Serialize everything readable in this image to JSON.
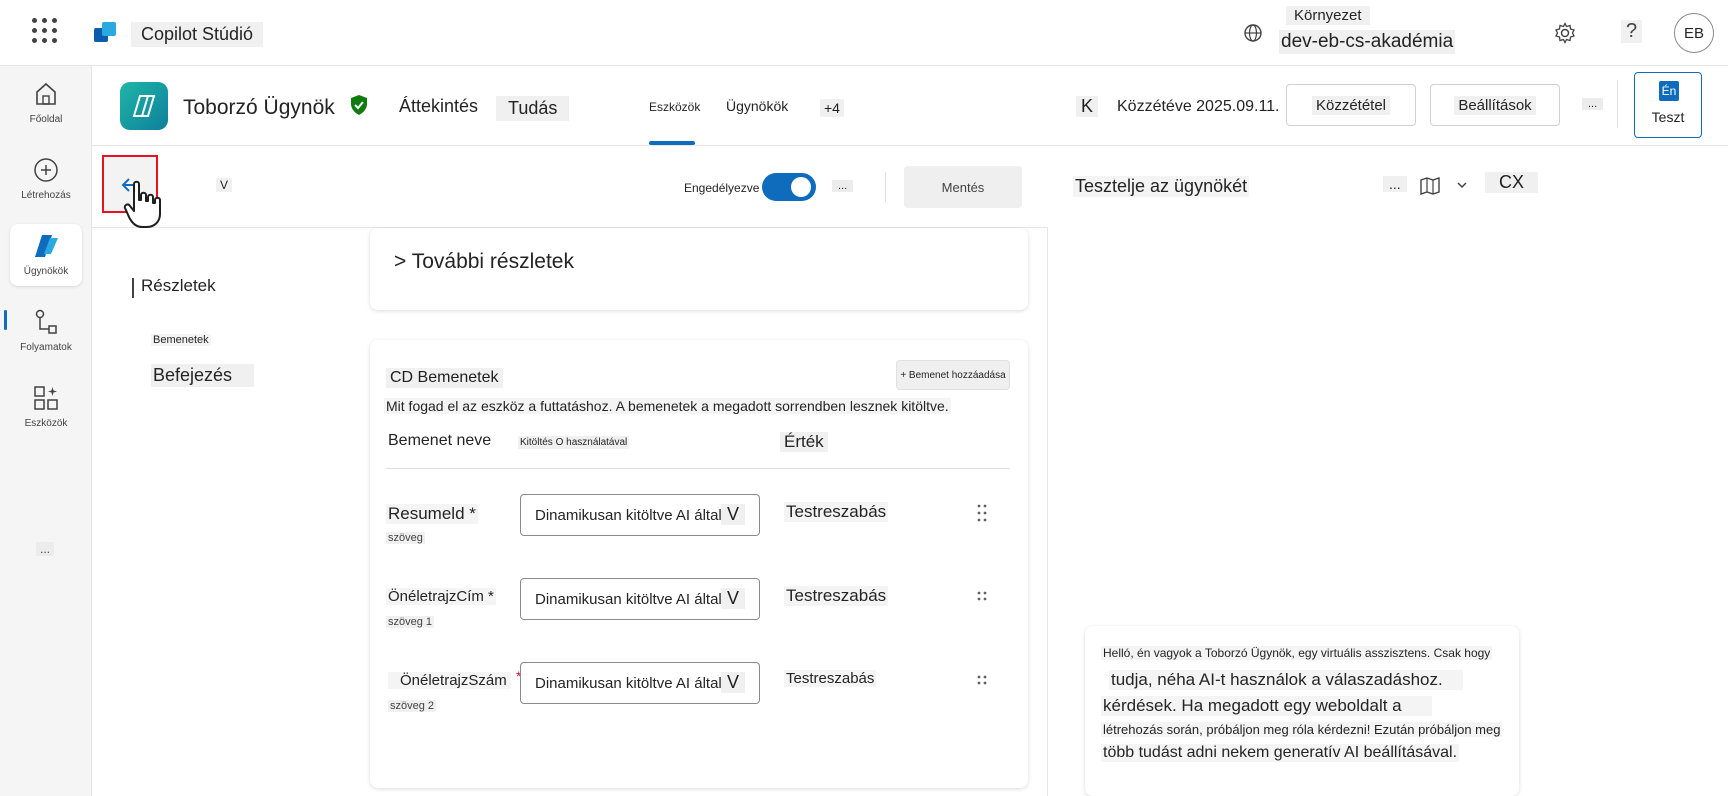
{
  "topbar": {
    "app_name": "Copilot Stúdió",
    "env_label": "Környezet",
    "env_name": "dev-eb-cs-akadémia",
    "help": "?",
    "avatar_initials": "EB"
  },
  "rail": {
    "home": "Főoldal",
    "create": "Létrehozás",
    "agents": "Ügynökök",
    "flows": "Folyamatok",
    "tools": "Eszközök",
    "more": "..."
  },
  "agent": {
    "name": "Toborzó Ügynök",
    "tabs": {
      "overview": "Áttekintés",
      "knowledge": "Tudás",
      "tools": "Eszközök",
      "agents": "Ügynökök",
      "more": "+4"
    },
    "k_label": "K",
    "published_status": "Közzétéve 2025.09.11.",
    "publish_button": "Közzététel",
    "settings_button": "Beállítások",
    "more": "...",
    "test_button": "Teszt",
    "test_icon_text": "Én"
  },
  "toolbar": {
    "dropdown_chevron": "V",
    "enabled_label": "Engedélyezve",
    "more": "...",
    "save_button": "Mentés"
  },
  "side_nav": {
    "details": "Részletek",
    "inputs": "Bemenetek",
    "completion": "Befejezés"
  },
  "more_details": "> További részletek",
  "inputs_card": {
    "title": "CD Bemenetek",
    "add_button": "+ Bemenet hozzáadása",
    "description": "Mit fogad el az eszköz a futtatáshoz. A bemenetek a megadott sorrendben lesznek kitöltve.",
    "col_name": "Bemenet neve",
    "col_fill": "Kitöltés O használatával",
    "col_value": "Érték",
    "rows": [
      {
        "name": "Resumeld *",
        "type": "szöveg",
        "fill": "Dinamikusan kitöltve AI által",
        "chevron": "V",
        "value": "Testreszabás"
      },
      {
        "name": "ÖnéletrajzCím *",
        "type": "szöveg 1",
        "fill": "Dinamikusan kitöltve AI által",
        "chevron": "V",
        "value": "Testreszabás"
      },
      {
        "name": "ÖnéletrajzSzám",
        "required_mark": "*",
        "type": "szöveg 2",
        "fill": "Dinamikusan kitöltve AI által",
        "chevron": "V",
        "value": "Testreszabás"
      }
    ]
  },
  "test_panel": {
    "title": "Tesztelje az ügynökét",
    "more": "...",
    "close": "CX",
    "message_lines": [
      "Helló, én vagyok a Toborzó Ügynök, egy virtuális asszisztens. Csak hogy",
      "tudja, néha AI-t használok a válaszadáshoz.",
      "kérdések. Ha megadott egy weboldalt a",
      "létrehozás során, próbáljon meg róla kérdezni! Ezután próbáljon meg",
      "több tudást adni nekem generatív AI beállításával."
    ]
  },
  "colors": {
    "accent": "#0f6cbd",
    "highlight_box": "#e81123",
    "verified": "#107c10"
  }
}
